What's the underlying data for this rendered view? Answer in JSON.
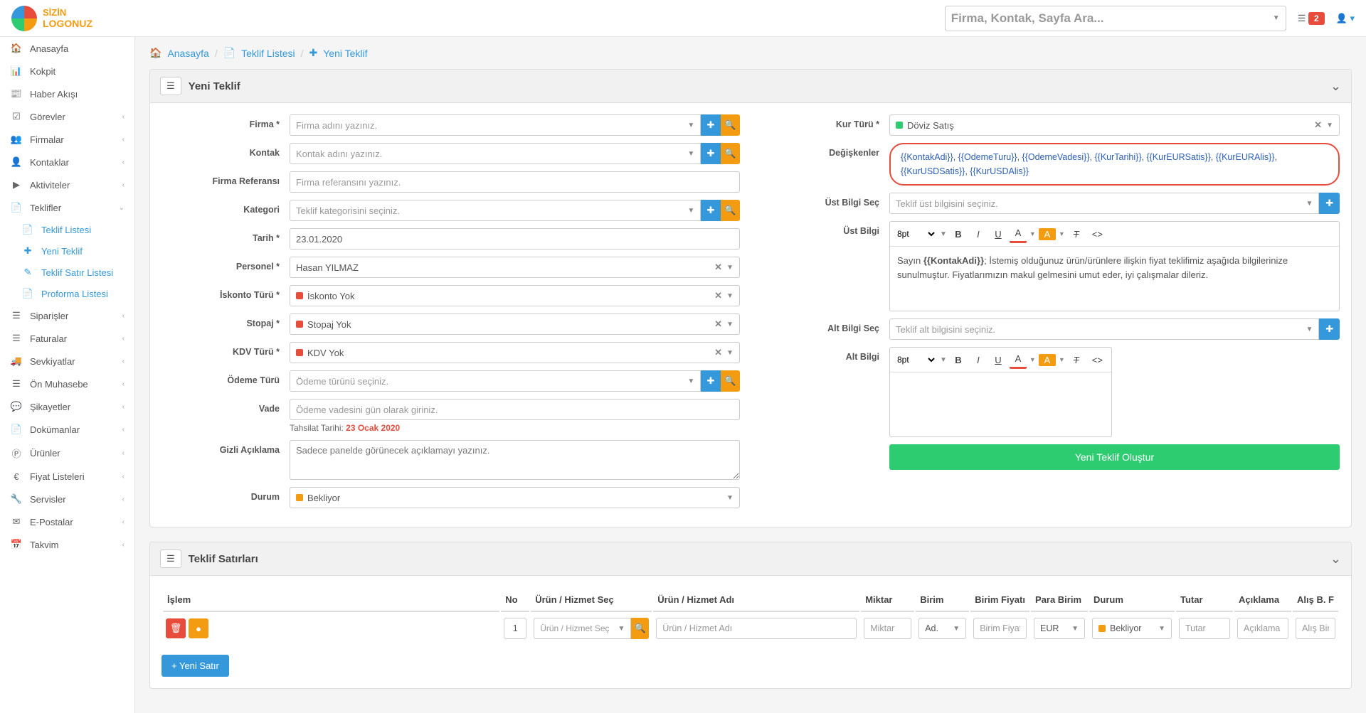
{
  "logo": {
    "line1": "SİZİN",
    "line2": "LOGONUZ"
  },
  "search_placeholder": "Firma, Kontak, Sayfa Ara...",
  "topbar": {
    "notif_count": "2"
  },
  "sidebar": {
    "items": [
      {
        "label": "Anasayfa",
        "icon": "home"
      },
      {
        "label": "Kokpit",
        "icon": "dash"
      },
      {
        "label": "Haber Akışı",
        "icon": "news"
      },
      {
        "label": "Görevler",
        "icon": "tasks",
        "chev": true
      },
      {
        "label": "Firmalar",
        "icon": "users",
        "chev": true
      },
      {
        "label": "Kontaklar",
        "icon": "user",
        "chev": true
      },
      {
        "label": "Aktiviteler",
        "icon": "video",
        "chev": true
      },
      {
        "label": "Teklifler",
        "icon": "file",
        "chev": true,
        "expanded": true,
        "children": [
          {
            "label": "Teklif Listesi",
            "icon": "file"
          },
          {
            "label": "Yeni Teklif",
            "icon": "plus"
          },
          {
            "label": "Teklif Satır Listesi",
            "icon": "pencil"
          },
          {
            "label": "Proforma Listesi",
            "icon": "file"
          }
        ]
      },
      {
        "label": "Siparişler",
        "icon": "list",
        "chev": true
      },
      {
        "label": "Faturalar",
        "icon": "list",
        "chev": true
      },
      {
        "label": "Sevkiyatlar",
        "icon": "truck",
        "chev": true
      },
      {
        "label": "Ön Muhasebe",
        "icon": "list",
        "chev": true
      },
      {
        "label": "Şikayetler",
        "icon": "comment",
        "chev": true
      },
      {
        "label": "Dokümanlar",
        "icon": "file",
        "chev": true
      },
      {
        "label": "Ürünler",
        "icon": "product",
        "chev": true
      },
      {
        "label": "Fiyat Listeleri",
        "icon": "euro",
        "chev": true
      },
      {
        "label": "Servisler",
        "icon": "wrench",
        "chev": true
      },
      {
        "label": "E-Postalar",
        "icon": "mail",
        "chev": true
      },
      {
        "label": "Takvim",
        "icon": "calendar",
        "chev": true
      }
    ]
  },
  "breadcrumb": {
    "home": "Anasayfa",
    "list": "Teklif Listesi",
    "new": "Yeni Teklif"
  },
  "panel1": {
    "title": "Yeni Teklif"
  },
  "labels": {
    "firma": "Firma *",
    "kontak": "Kontak",
    "ref": "Firma Referansı",
    "kategori": "Kategori",
    "tarih": "Tarih *",
    "personel": "Personel *",
    "iskonto": "İskonto Türü *",
    "stopaj": "Stopaj *",
    "kdv": "KDV Türü *",
    "odeme": "Ödeme Türü",
    "vade": "Vade",
    "gizli": "Gizli Açıklama",
    "durum": "Durum",
    "kur": "Kur Türü *",
    "degiskenler": "Değişkenler",
    "ustsec": "Üst Bilgi Seç",
    "ust": "Üst Bilgi",
    "altsec": "Alt Bilgi Seç",
    "alt": "Alt Bilgi"
  },
  "placeholders": {
    "firma": "Firma adını yazınız.",
    "kontak": "Kontak adını yazınız.",
    "ref": "Firma referansını yazınız.",
    "kategori": "Teklif kategorisini seçiniz.",
    "odeme": "Ödeme türünü seçiniz.",
    "vade": "Ödeme vadesini gün olarak giriniz.",
    "gizli": "Sadece panelde görünecek açıklamayı yazınız.",
    "ustsec": "Teklif üst bilgisini seçiniz.",
    "altsec": "Teklif alt bilgisini seçiniz."
  },
  "values": {
    "tarih": "23.01.2020",
    "personel": "Hasan YILMAZ",
    "iskonto": "İskonto Yok",
    "stopaj": "Stopaj Yok",
    "kdv": "KDV Yok",
    "durum": "Bekliyor",
    "kur": "Döviz Satış",
    "tahsilat_label": "Tahsilat Tarihi: ",
    "tahsilat_date": "23 Ocak 2020"
  },
  "variables": [
    "{{KontakAdi}}",
    "{{OdemeTuru}}",
    "{{OdemeVadesi}}",
    "{{KurTarihi}}",
    "{{KurEURSatis}}",
    "{{KurEURAlis}}",
    "{{KurUSDSatis}}",
    "{{KurUSDAlis}}"
  ],
  "editor": {
    "fontsize": "8pt",
    "ust_content_prefix": "Sayın ",
    "ust_content_bold": "{{KontakAdi}}",
    "ust_content_rest": "; İstemiş olduğunuz ürün/ürünlere ilişkin fiyat teklifimiz aşağıda bilgilerinize sunulmuştur. Fiyatlarımızın makul gelmesini umut eder, iyi çalışmalar dileriz."
  },
  "submit": "Yeni Teklif Oluştur",
  "panel2": {
    "title": "Teklif Satırları"
  },
  "table": {
    "headers": {
      "islem": "İşlem",
      "no": "No",
      "urunsel": "Ürün / Hizmet Seç",
      "urunadi": "Ürün / Hizmet Adı",
      "miktar": "Miktar",
      "birim": "Birim",
      "fiyat": "Birim Fiyatı",
      "parabirim": "Para Birim",
      "durum": "Durum",
      "tutar": "Tutar",
      "aciklama": "Açıklama",
      "alis": "Alış B. F"
    },
    "row": {
      "no": "1",
      "urunsel": "Ürün / Hizmet Seç",
      "urunadi": "Ürün / Hizmet Adı",
      "miktar": "Miktar",
      "birim": "Ad.",
      "fiyat": "Birim Fiyat",
      "parabirim": "EUR",
      "durum": "Bekliyor",
      "tutar": "Tutar",
      "aciklama": "Açıklama",
      "alis": "Alış Bir"
    }
  },
  "add_row": "+ Yeni Satır"
}
